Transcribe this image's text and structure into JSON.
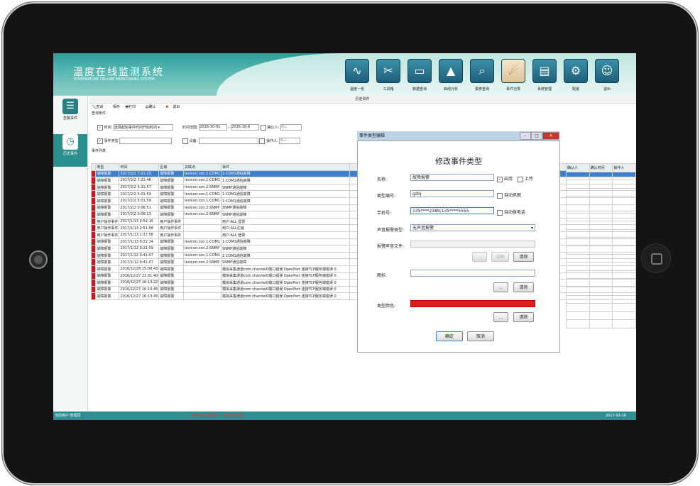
{
  "app": {
    "title_cn": "温度在线监测系统",
    "title_en": "TEMPERATURE ON-LINE MONITORING SYSTEM",
    "tools": [
      {
        "icon": "waveform-icon",
        "label": "温度一览"
      },
      {
        "icon": "tools-icon",
        "label": "工具箱"
      },
      {
        "icon": "monitor-icon",
        "label": "数据查询"
      },
      {
        "icon": "chart-icon",
        "label": "曲线分析"
      },
      {
        "icon": "magnifier-icon",
        "label": "报表查询"
      },
      {
        "icon": "event-icon",
        "label": "事件记录"
      },
      {
        "icon": "report-icon",
        "label": "系统管理"
      },
      {
        "icon": "gear-icon",
        "label": "配置"
      },
      {
        "icon": "user-icon",
        "label": "退出"
      }
    ],
    "active_tool": 5
  },
  "sidebar": [
    {
      "icon": "list-icon",
      "label": "告警事件"
    },
    {
      "icon": "history-icon",
      "label": "历史事件"
    }
  ],
  "main": {
    "title": "历史事件",
    "toolbar": [
      "查询",
      "保存",
      "打印",
      "确认",
      "退出"
    ],
    "query_group": "查询条件",
    "filter_time": "时间:",
    "filter_time_val": "选择起始事件时间开始时间",
    "filter_date_label": "时间范围:",
    "date_from": "2016-10-01",
    "date_to": "2016-10-6",
    "confirmed_label": "确认人:",
    "confirmed_val": "ALL",
    "filter_type": "事件类型",
    "filter_area": "设备:",
    "handler_label": "操作人:",
    "handler_val": "ALL",
    "list_group": "事件列表",
    "columns": [
      "类型",
      "时间",
      "区域",
      "关联点",
      "事件"
    ],
    "right_columns": [
      "确认人",
      "确认时间",
      "操作人"
    ],
    "rows": [
      {
        "t": "故障报警",
        "d": "2017/2/2 7:21:15",
        "a": "故障报警",
        "p": "levicon:con.1:COM1",
        "e": "1:COM1通信故障",
        "sel": true
      },
      {
        "t": "故障报警",
        "d": "2017/2/2 7:21:48",
        "a": "故障报警",
        "p": "levicon:con.1:COM1",
        "e": "1:COM1通信故障"
      },
      {
        "t": "故障报警",
        "d": "2017/2/2 5:31:57",
        "a": "故障报警",
        "p": "levicon:con.2:SNMP",
        "e": "SNMP通信故障"
      },
      {
        "t": "故障报警",
        "d": "2017/2/2 5:01:59",
        "a": "故障报警",
        "p": "levicon:con.1:COM1",
        "e": "1:COM1通信故障"
      },
      {
        "t": "故障报警",
        "d": "2017/2/2 5:01:59",
        "a": "故障报警",
        "p": "levicon:con.1:COM1",
        "e": "1:COM1通信故障"
      },
      {
        "t": "故障报警",
        "d": "2017/2/2 0:06:51",
        "a": "故障报警",
        "p": "levicon:con.2:SNMP",
        "e": "SNMP通信故障"
      },
      {
        "t": "故障报警",
        "d": "2017/2/2 0:06:13",
        "a": "故障报警",
        "p": "levicon:con.2:SNMP",
        "e": "SNMP通信故障"
      },
      {
        "t": "用户操作事件",
        "d": "2017/1/13 2:52:15",
        "a": "用户操作事件",
        "p": "",
        "e": "用户:ALL 登录"
      },
      {
        "t": "用户操作事件",
        "d": "2017/1/13 2:51:58",
        "a": "用户操作事件",
        "p": "",
        "e": "用户:ALL注销"
      },
      {
        "t": "用户操作事件",
        "d": "2017/1/13 1:37:58",
        "a": "用户操作事件",
        "p": "",
        "e": "用户:ALL 登录"
      },
      {
        "t": "故障报警",
        "d": "2017/1/13 0:22:14",
        "a": "故障报警",
        "p": "levicon:con.1:COM1",
        "e": "1:COM1通信故障"
      },
      {
        "t": "故障报警",
        "d": "2017/1/12 0:21:59",
        "a": "故障报警",
        "p": "levicon:con.2:SNMP",
        "e": "SNMP通信故障"
      },
      {
        "t": "故障报警",
        "d": "2017/1/12 9:41:07",
        "a": "故障报警",
        "p": "levicon:con.1:COM1",
        "e": "1:COM1通信故障"
      },
      {
        "t": "故障报警",
        "d": "2017/1/12 9:41:07",
        "a": "故障报警",
        "p": "levicon:con.2:SNMP",
        "e": "SNMP通信故障"
      },
      {
        "t": "故障报警",
        "d": "2016/12/28 15:08:43",
        "a": "故障报警",
        "p": "",
        "e": "模拟采集通道com channel0端口错误 OpenPort 连接TCP服务端错误 0"
      },
      {
        "t": "故障报警",
        "d": "2016/12/27 21:31:40",
        "a": "故障报警",
        "p": "",
        "e": "模拟采集通道com channel0端口错误 OpenPort 连接TCP服务端错误 0"
      },
      {
        "t": "故障报警",
        "d": "2016/12/27 16:13:22",
        "a": "故障报警",
        "p": "",
        "e": "模拟采集通道com channel0端口错误 OpenPort 连接TCP服务端错误 0"
      },
      {
        "t": "故障报警",
        "d": "2016/12/27 16:13:45",
        "a": "故障报警",
        "p": "",
        "e": "模拟采集通道com channel0端口错误 OpenPort 连接TCP服务端错误 0"
      },
      {
        "t": "故障报警",
        "d": "2016/12/27 16:13:45",
        "a": "故障报警",
        "p": "",
        "e": "模拟采集通道com channel0端口错误 OpenPort 连接TCP服务端错误 0"
      }
    ]
  },
  "status": {
    "left": "当前用户:管理员",
    "middle": "系统状态信息提示，请联系管理员",
    "right": "2017-03-16"
  },
  "dialog": {
    "window_title": "事件类型编辑",
    "heading": "修改事件类型",
    "name_label": "名称:",
    "name_value": "故障报警",
    "enable_label": "启用",
    "upload_label": "上传",
    "code_label": "类型编号:",
    "code_value": "gzbj",
    "autoscan_label": "自动抓图",
    "phone_label": "手机号:",
    "phone_value": "135****2389;135****5555",
    "autodial_label": "自动拨电话",
    "sound_type_label": "声音报警类型:",
    "sound_type_value": "无声音报警",
    "sound_file_label": "报警声音文件:",
    "sound_file_value": "",
    "browse": "...",
    "test": "试听",
    "clear": "清除",
    "icon_label": "图标:",
    "icon_value": "",
    "color_label": "类型颜色:",
    "color_value": "#dd1c1c",
    "ok": "确定",
    "cancel": "取消"
  }
}
